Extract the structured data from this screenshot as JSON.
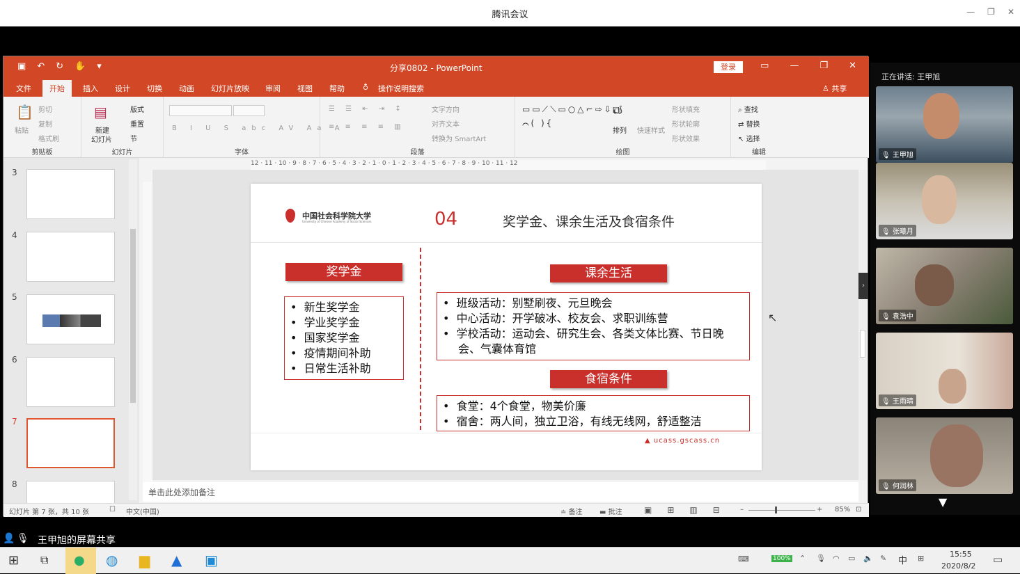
{
  "meeting": {
    "title": "腾讯会议",
    "speaking": "正在讲话: 王甲旭",
    "share_label": "王甲旭的屏幕共享"
  },
  "ppt": {
    "doc_title": "分享0802 - PowerPoint",
    "login": "登录",
    "share": "共享",
    "tabs": [
      "文件",
      "开始",
      "插入",
      "设计",
      "切换",
      "动画",
      "幻灯片放映",
      "审阅",
      "视图",
      "帮助",
      "操作说明搜索"
    ],
    "ribbon": {
      "clipboard": {
        "paste": "粘贴",
        "cut": "剪切",
        "copy": "复制",
        "painter": "格式刷",
        "label": "剪贴板"
      },
      "slides": {
        "new": "新建",
        "new2": "幻灯片",
        "layout": "版式",
        "reset": "重置",
        "section": "节",
        "label": "幻灯片"
      },
      "font": {
        "label": "字体"
      },
      "paragraph": {
        "text_dir": "文字方向",
        "align_text": "对齐文本",
        "smartart": "转换为 SmartArt",
        "label": "段落"
      },
      "drawing": {
        "arrange": "排列",
        "quick": "快速样式",
        "fill": "形状填充",
        "outline": "形状轮廓",
        "effect": "形状效果",
        "label": "绘图"
      },
      "editing": {
        "find": "查找",
        "replace": "替换",
        "select": "选择",
        "label": "编辑"
      }
    },
    "ruler": "12 · 11 · 10 · 9 · 8 · 7 · 6 · 5 · 4 · 3 · 2 · 1 · 0 · 1 · 2 · 3 · 4 · 5 · 6 · 7 · 8 · 9 · 10 · 11 · 12",
    "thumb_numbers": [
      "3",
      "4",
      "5",
      "6",
      "7",
      "8"
    ],
    "notes": "单击此处添加备注",
    "status": {
      "slide": "幻灯片 第 7 张，共 10 张",
      "lang": "中文(中国)",
      "notes": "备注",
      "comments": "批注",
      "zoom": "85%"
    }
  },
  "slide": {
    "logo": "中国社会科学院大学",
    "logo_en": "University of Chinese Academy of Social Sciences",
    "num": "04",
    "title": "奖学金、课余生活及食宿条件",
    "scholarship": {
      "header": "奖学金",
      "items": [
        "新生奖学金",
        "学业奖学金",
        "国家奖学金",
        "疫情期间补助",
        "日常生活补助"
      ]
    },
    "life": {
      "header": "课余生活",
      "items": [
        "班级活动：别墅刷夜、元旦晚会",
        "中心活动：开学破冰、校友会、求职训练营",
        "学校活动：运动会、研究生会、各类文体比赛、节日晚会、气囊体育馆"
      ]
    },
    "board": {
      "header": "食宿条件",
      "items": [
        "食堂：4个食堂，物美价廉",
        "宿舍：两人间，独立卫浴，有线无线网，舒适整洁"
      ]
    },
    "url": "ucass.gscass.cn"
  },
  "participants": [
    {
      "name": "王甲旭"
    },
    {
      "name": "张曦月"
    },
    {
      "name": "袁浩中"
    },
    {
      "name": "王雨晴"
    },
    {
      "name": "何润林"
    }
  ],
  "taskbar": {
    "time": "15:55",
    "date": "2020/8/2",
    "battery": "100%",
    "ime": "中"
  },
  "colors": {
    "ppt_orange": "#d24726",
    "slide_red": "#c9302c"
  }
}
